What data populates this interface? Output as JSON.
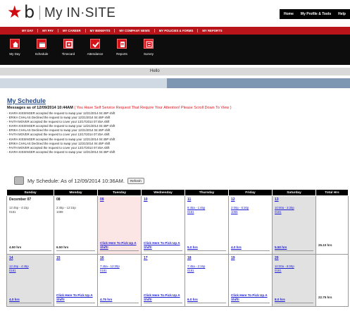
{
  "header": {
    "logo_star": "★",
    "logo_b": "b",
    "app_title": "My IN·SITE",
    "utility": [
      "Home",
      "My Profile & Tools",
      "Help"
    ]
  },
  "topnav": [
    "MY DAY",
    "MY PAY",
    "MY CAREER",
    "MY BENEFITS",
    "MY COMPANY NEWS",
    "MY POLICIES & FORMS",
    "MY REPORTS"
  ],
  "iconbar": [
    {
      "label": "My Day",
      "icon": "home-icon"
    },
    {
      "label": "Schedule",
      "icon": "schedule-icon"
    },
    {
      "label": "Timecard",
      "icon": "timecard-icon"
    },
    {
      "label": "Attendance",
      "icon": "attendance-check-icon"
    },
    {
      "label": "Reports",
      "icon": "reports-icon"
    },
    {
      "label": "Survey",
      "icon": "survey-icon"
    }
  ],
  "hello": "Hello",
  "schedule_title": "My Schedule",
  "messages": {
    "heading": "Messages as of 12/09/2014 10:44AM",
    "warning": "( You Have Self Service Request That Require Your Attention! Please Scroll Down To View )",
    "items": [
      "- KIARA KISSINGER accepted the request to swap your 12/21/2014 04:45P shift",
      "- ERIKA CHALAS Declined the request to swap your 12/21/2014 04:45P shift",
      "- FAITH MOVER accepted the request to cover your 12/17/2014 07:45A shift",
      "- KIARA KISSINGER accepted the request to swap your 12/21/2014 04:45P shift",
      "- ERIKA CHALAS Declined the request to swap your 12/21/2014 04:45P shift",
      "- FAITH MOVER accepted the request to cover your 12/17/2014 07:45A shift",
      "- KIARA KISSINGER accepted the request to swap your 12/21/2014 04:45P shift",
      "- ERIKA CHALAS Declined the request to swap your 12/21/2014 04:45P shift",
      "- FAITH MOVER accepted the request to cover your 12/17/2014 07:45A shift",
      "- KIARA KISSINGER accepted the request to swap your 12/21/2014 04:45P shift"
    ]
  },
  "schedule_header": {
    "text": "My Schedule: As of 12/09/2014 10:36AM.",
    "refresh_label": "Refresh"
  },
  "calendar": {
    "columns": [
      "Sunday",
      "Monday",
      "Tuesday",
      "Wednesday",
      "Thursday",
      "Friday",
      "Saturday",
      "Total Hrs"
    ],
    "weeks": [
      {
        "total": "25.10 hrs",
        "days": [
          {
            "date": "December 07",
            "shift": "12:45p - 4:15p",
            "dept": "0181",
            "bottom": "4.50 hrs",
            "link": false,
            "style": ""
          },
          {
            "date": "08",
            "shift": "2:45p - 12:15p",
            "dept": "1089",
            "bottom": "6.50 hrs",
            "link": false,
            "style": ""
          },
          {
            "date": "09",
            "shift": "",
            "dept": "",
            "bottom": "Click Here To Pick Up A Shift!",
            "link": true,
            "style": "pink"
          },
          {
            "date": "10",
            "shift": "",
            "dept": "",
            "bottom": "Click Here To Pick Up A Shift!",
            "link": true,
            "style": ""
          },
          {
            "date": "11",
            "shift": "8:45a - 1:45p",
            "dept": "0181",
            "bottom": "5.0 hrs",
            "link": true,
            "style": ""
          },
          {
            "date": "12",
            "shift": "2:00p - 6:30p",
            "dept": "1065",
            "bottom": "4.0 hrs",
            "link": true,
            "style": ""
          },
          {
            "date": "13",
            "shift": "10:00a - 3:30p",
            "dept": "0181",
            "bottom": "5.50 hrs",
            "link": true,
            "style": "grey"
          }
        ]
      },
      {
        "total": "22.75 hrs",
        "days": [
          {
            "date": "14",
            "shift": "12:45p - 4:45p",
            "dept": "0181",
            "bottom": "4.0 hrs",
            "link": true,
            "style": "grey"
          },
          {
            "date": "15",
            "shift": "",
            "dept": "",
            "bottom": "Click Here To Pick Up A Shift!",
            "link": true,
            "style": ""
          },
          {
            "date": "16",
            "shift": "7:45a - 12:30p",
            "dept": "0181",
            "bottom": "4.75 hrs",
            "link": true,
            "style": ""
          },
          {
            "date": "17",
            "shift": "",
            "dept": "",
            "bottom": "Click Here To Pick Up A Shift!",
            "link": true,
            "style": ""
          },
          {
            "date": "18",
            "shift": "7:45a - 2:15p",
            "dept": "0181",
            "bottom": "6.0 hrs",
            "link": true,
            "style": ""
          },
          {
            "date": "19",
            "shift": "",
            "dept": "",
            "bottom": "Click Here To Pick Up A Shift!",
            "link": true,
            "style": ""
          },
          {
            "date": "20",
            "shift": "10:00a - 8:00p",
            "dept": "0181",
            "bottom": "8.0 hrs",
            "link": true,
            "style": "grey"
          }
        ]
      }
    ]
  },
  "colors": {
    "brand_red": "#b8141a",
    "icon_red": "#d6121a",
    "link_blue": "#1a1ad0",
    "warning_red": "#e0161f",
    "header_blue": "#7d97b3"
  }
}
